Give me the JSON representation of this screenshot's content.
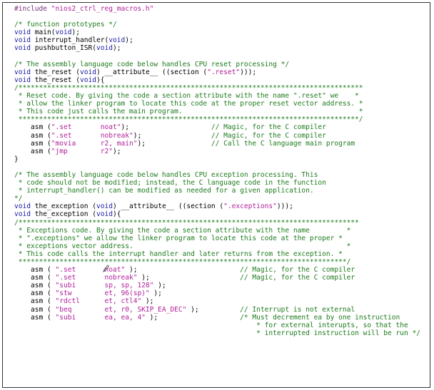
{
  "lines": [
    [
      [
        "pp",
        "#include "
      ],
      [
        "st",
        "\"nios2_ctrl_reg_macros.h\""
      ]
    ],
    [],
    [
      [
        "cm",
        "/* function prototypes */"
      ]
    ],
    [
      [
        "kw",
        "void"
      ],
      [
        "tx",
        " main("
      ],
      [
        "kw",
        "void"
      ],
      [
        "tx",
        ");"
      ]
    ],
    [
      [
        "kw",
        "void"
      ],
      [
        "tx",
        " interrupt_handler("
      ],
      [
        "kw",
        "void"
      ],
      [
        "tx",
        ");"
      ]
    ],
    [
      [
        "kw",
        "void"
      ],
      [
        "tx",
        " pushbutton_ISR("
      ],
      [
        "kw",
        "void"
      ],
      [
        "tx",
        ");"
      ]
    ],
    [],
    [
      [
        "cm",
        "/* The assembly language code below handles CPU reset processing */"
      ]
    ],
    [
      [
        "kw",
        "void"
      ],
      [
        "tx",
        " the_reset ("
      ],
      [
        "kw",
        "void"
      ],
      [
        "tx",
        ") __attribute__ ((section ("
      ],
      [
        "st",
        "\".reset\""
      ],
      [
        "tx",
        ")));"
      ]
    ],
    [
      [
        "kw",
        "void"
      ],
      [
        "tx",
        " the_reset ("
      ],
      [
        "kw",
        "void"
      ],
      [
        "tx",
        "){"
      ]
    ],
    [
      [
        "cm",
        "/************************************************************************************"
      ]
    ],
    [
      [
        "cm",
        " * Reset code. By giving the code a section attribute with the name \".reset\" we    *"
      ]
    ],
    [
      [
        "cm",
        " * allow the linker program to locate this code at the proper reset vector address. *"
      ]
    ],
    [
      [
        "cm",
        " * This code just calls the main program.                                           *"
      ]
    ],
    [
      [
        "cm",
        " ***********************************************************************************/"
      ]
    ],
    [
      [
        "tx",
        "    asm ("
      ],
      [
        "st",
        "\".set       noat\""
      ],
      [
        "tx",
        ");                    "
      ],
      [
        "cm",
        "// Magic, for the C compiler"
      ]
    ],
    [
      [
        "tx",
        "    asm ("
      ],
      [
        "st",
        "\".set       nobreak\""
      ],
      [
        "tx",
        ");                 "
      ],
      [
        "cm",
        "// Magic, for the C compiler"
      ]
    ],
    [
      [
        "tx",
        "    asm ("
      ],
      [
        "st",
        "\"movia      r2, main\""
      ],
      [
        "tx",
        ");                "
      ],
      [
        "cm",
        "// Call the C language main program"
      ]
    ],
    [
      [
        "tx",
        "    asm ("
      ],
      [
        "st",
        "\"jmp        r2\""
      ],
      [
        "tx",
        ");"
      ]
    ],
    [
      [
        "tx",
        "}"
      ]
    ],
    [],
    [
      [
        "cm",
        "/* The assembly language code below handles CPU exception processing. This"
      ]
    ],
    [
      [
        "cm",
        " * code should not be modified; instead, the C language code in the function"
      ]
    ],
    [
      [
        "cm",
        " * interrupt_handler() can be modified as needed for a given application."
      ]
    ],
    [
      [
        "cm",
        "*/"
      ]
    ],
    [
      [
        "kw",
        "void"
      ],
      [
        "tx",
        " the_exception ("
      ],
      [
        "kw",
        "void"
      ],
      [
        "tx",
        ") __attribute__ ((section ("
      ],
      [
        "st",
        "\".exceptions\""
      ],
      [
        "tx",
        ")));"
      ]
    ],
    [
      [
        "kw",
        "void"
      ],
      [
        "tx",
        " the_exception ("
      ],
      [
        "kw",
        "void"
      ],
      [
        "tx",
        "){"
      ]
    ],
    [
      [
        "cm",
        "/***********************************************************************************"
      ]
    ],
    [
      [
        "cm",
        " * Exceptions code. By giving the code a section attribute with the name         *"
      ]
    ],
    [
      [
        "cm",
        " * \".exceptions\" we allow the linker program to locate this code at the proper *"
      ]
    ],
    [
      [
        "cm",
        " * exceptions vector address.                                                    *"
      ]
    ],
    [
      [
        "cm",
        " * This code calls the interrupt handler and later returns from the exception. *"
      ]
    ],
    [
      [
        "cm",
        " ********************************************************************************/"
      ]
    ],
    [
      [
        "tx",
        "    asm ( "
      ],
      [
        "st",
        "\".set       noat\""
      ],
      [
        "tx",
        " );                         "
      ],
      [
        "cm",
        "// Magic, for the C compiler"
      ]
    ],
    [
      [
        "tx",
        "    asm ( "
      ],
      [
        "st",
        "\".set       nobreak\""
      ],
      [
        "tx",
        " );                      "
      ],
      [
        "cm",
        "// Magic, for the C compiler"
      ]
    ],
    [
      [
        "tx",
        "    asm ( "
      ],
      [
        "st",
        "\"subi       sp, sp, 128\""
      ],
      [
        "tx",
        " );"
      ]
    ],
    [
      [
        "tx",
        "    asm ( "
      ],
      [
        "st",
        "\"stw        et, 96(sp)\""
      ],
      [
        "tx",
        " );"
      ]
    ],
    [
      [
        "tx",
        "    asm ( "
      ],
      [
        "st",
        "\"rdctl      et, ctl4\""
      ],
      [
        "tx",
        " );"
      ]
    ],
    [
      [
        "tx",
        "    asm ( "
      ],
      [
        "st",
        "\"beq        et, r0, SKIP_EA_DEC\""
      ],
      [
        "tx",
        " );          "
      ],
      [
        "cm",
        "// Interrupt is not external"
      ]
    ],
    [
      [
        "tx",
        "    asm ( "
      ],
      [
        "st",
        "\"subi       ea, ea, 4\""
      ],
      [
        "tx",
        " );                    "
      ],
      [
        "cm",
        "/* Must decrement ea by one instruction"
      ]
    ],
    [
      [
        "tx",
        "                                                           "
      ],
      [
        "cm",
        "* for external interupts, so that the"
      ]
    ],
    [
      [
        "tx",
        "                                                           "
      ],
      [
        "cm",
        "* interrupted instruction will be run */"
      ]
    ]
  ],
  "colors": {
    "keyword": "#1a1aa6",
    "comment": "#1e7b1e",
    "string": "#b0209a",
    "preprocessor": "#7a2e7a",
    "text": "#000000"
  }
}
